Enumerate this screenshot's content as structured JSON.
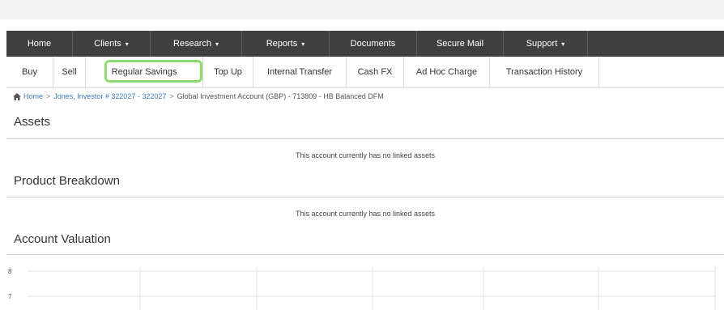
{
  "top_nav": {
    "items": [
      {
        "label": "Home",
        "caret": ""
      },
      {
        "label": "Clients",
        "caret": "▾"
      },
      {
        "label": "Research",
        "caret": "▾"
      },
      {
        "label": "Reports",
        "caret": "▾"
      },
      {
        "label": "Documents",
        "caret": ""
      },
      {
        "label": "Secure Mail",
        "caret": ""
      },
      {
        "label": "Support",
        "caret": "▾"
      }
    ]
  },
  "sub_nav": {
    "items": [
      {
        "label": "Buy"
      },
      {
        "label": "Sell"
      },
      {
        "label": "Regular Savings"
      },
      {
        "label": "Top Up"
      },
      {
        "label": "Internal Transfer"
      },
      {
        "label": "Cash FX"
      },
      {
        "label": "Ad Hoc Charge"
      },
      {
        "label": "Transaction History"
      }
    ],
    "highlighted": "Regular Savings",
    "highlight_color": "#8fdc6e"
  },
  "breadcrumb": {
    "home": "Home",
    "separator": ">",
    "investor": "Jones, Investor # 322027 - 322027",
    "account": "Global Investment Account (GBP) - 713809 - HB Balanced DFM"
  },
  "sections": {
    "assets": {
      "title": "Assets",
      "message": "This account currently has no linked assets"
    },
    "product_breakdown": {
      "title": "Product Breakdown",
      "message": "This account currently has no linked assets"
    },
    "account_valuation": {
      "title": "Account Valuation"
    }
  },
  "chart_data": {
    "type": "line",
    "series": [],
    "yticks": [
      "8",
      "7"
    ],
    "grid": true
  },
  "colors": {
    "nav_background": "#3f3f3f",
    "link": "#3d7ebd"
  }
}
